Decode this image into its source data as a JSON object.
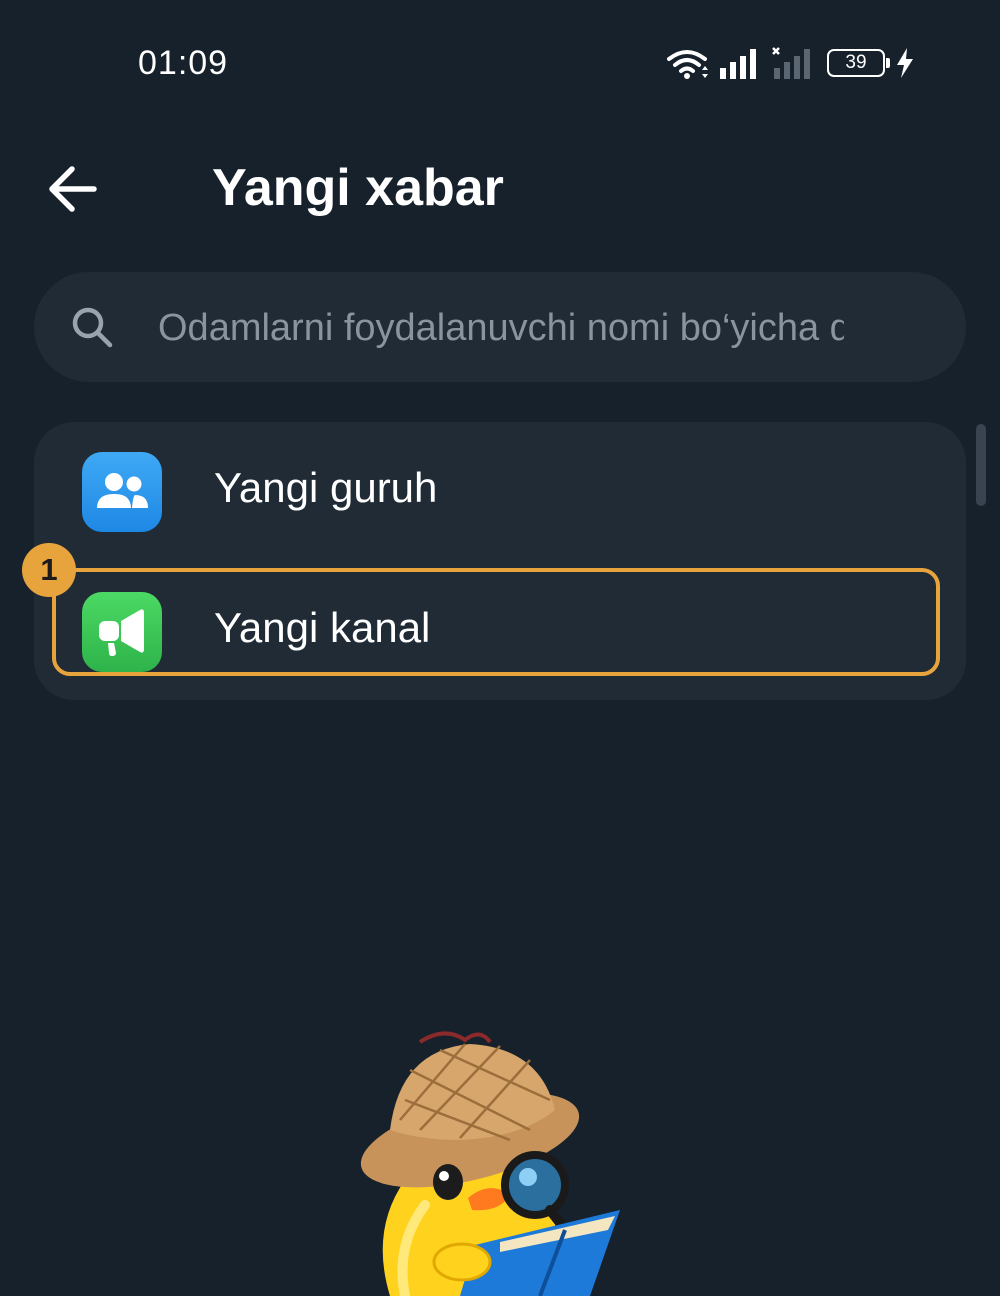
{
  "status_bar": {
    "time": "01:09",
    "battery_level": "39",
    "icons": [
      "wifi-icon",
      "signal-icon",
      "signal-no-service-icon",
      "battery-icon",
      "charging-icon"
    ]
  },
  "header": {
    "title": "Yangi xabar",
    "back_icon": "arrow-left-icon"
  },
  "search": {
    "placeholder": "Odamlarni foydalanuvchi nomi bo‘yicha qidiring",
    "value": "",
    "icon": "search-icon"
  },
  "menu": {
    "items": [
      {
        "label": "Yangi guruh",
        "icon": "group-icon",
        "icon_color": "#2196f3"
      },
      {
        "label": "Yangi kanal",
        "icon": "megaphone-icon",
        "icon_color": "#35c04e"
      }
    ]
  },
  "annotation": {
    "step": "1",
    "color": "#e8a43c"
  },
  "colors": {
    "background": "#17212b",
    "card": "#202b36",
    "placeholder": "#8a949e"
  }
}
